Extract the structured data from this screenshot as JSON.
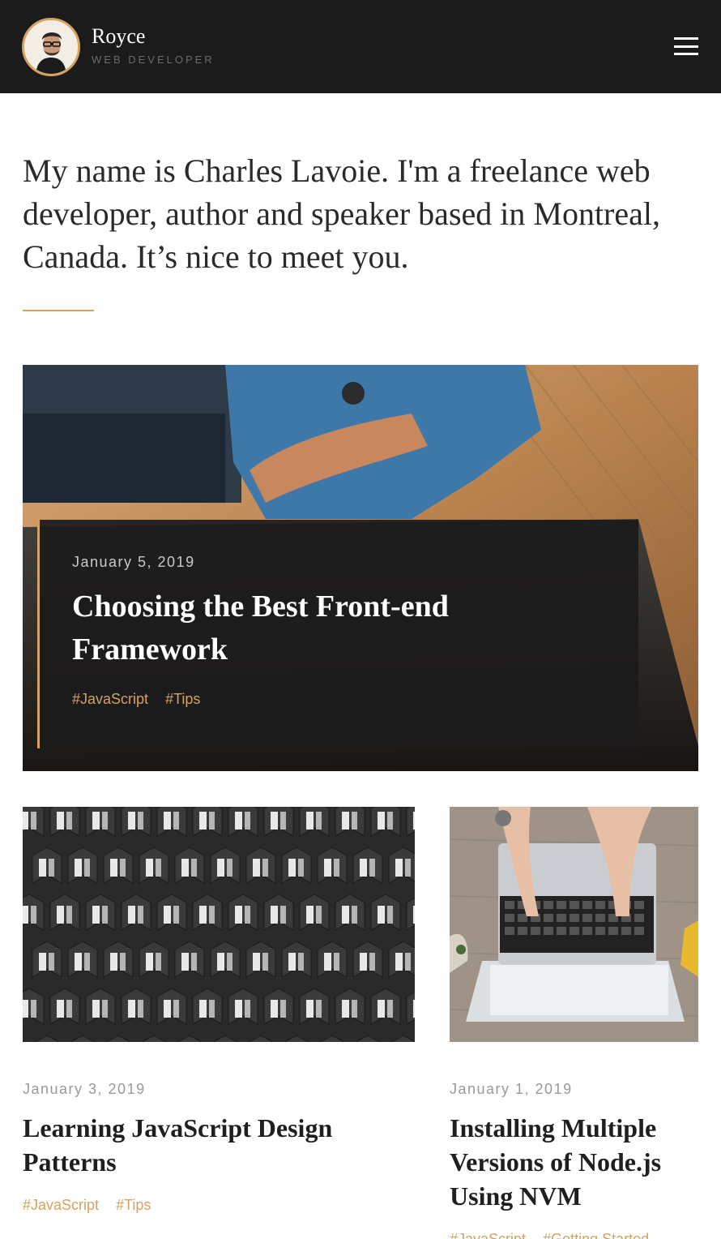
{
  "header": {
    "brand_name": "Royce",
    "brand_role": "WEB DEVELOPER",
    "menu_icon": "hamburger-menu-icon"
  },
  "intro": {
    "text": "My name is Charles Lavoie. I'm a freelance web developer, author and speaker based in Montreal, Canada. It’s nice to meet you."
  },
  "featured": {
    "date": "January 5, 2019",
    "title": "Choosing the Best Front-end Framework",
    "tags": [
      "#JavaScript",
      "#Tips"
    ]
  },
  "posts": [
    {
      "date": "January 3, 2019",
      "title": "Learning JavaScript Design Patterns",
      "tags": [
        "#JavaScript",
        "#Tips"
      ]
    },
    {
      "date": "January 1, 2019",
      "title": "Installing Multiple Versions of Node.js Using NVM",
      "tags": [
        "#JavaScript",
        "#Getting Started"
      ]
    }
  ],
  "colors": {
    "accent": "#d3a35f",
    "header_bg": "#1c1b1c"
  }
}
